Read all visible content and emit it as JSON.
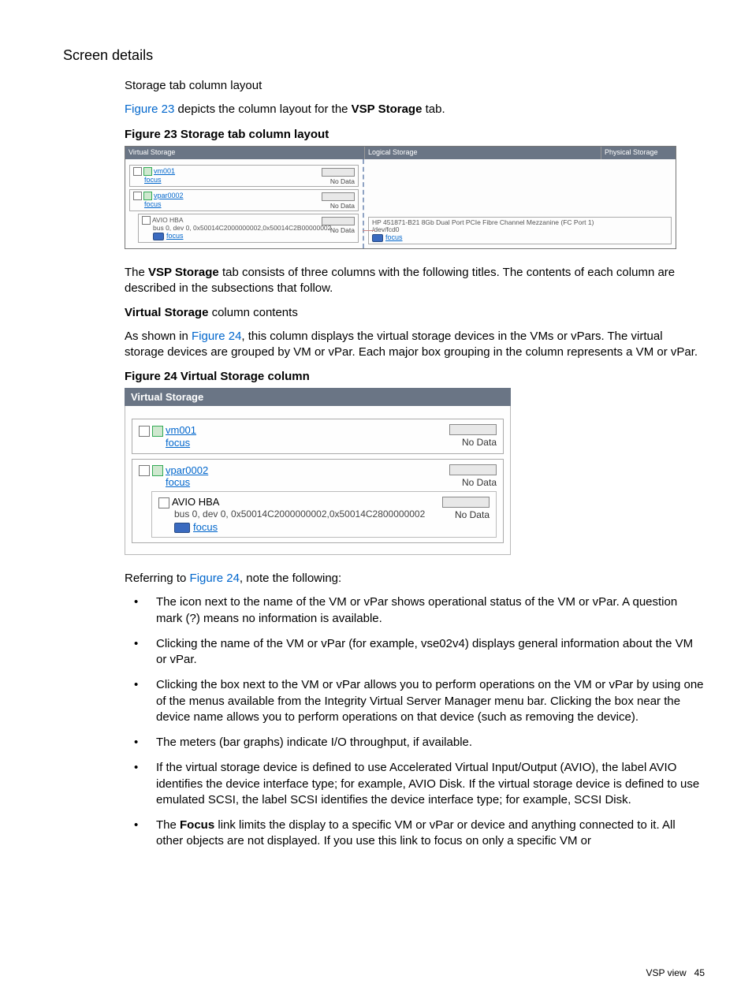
{
  "headings": {
    "screen_details": "Screen details",
    "subheading": "Storage tab column layout"
  },
  "intro": {
    "ref1": "Figure 23",
    "sentence1_rest": " depicts the column layout for the ",
    "vsp_storage": "VSP Storage",
    "sentence1_end": " tab."
  },
  "fig23": {
    "caption": "Figure 23 Storage tab column layout",
    "cols": {
      "virtual": "Virtual Storage",
      "logical": "Logical Storage",
      "physical": "Physical Storage"
    },
    "vm001": {
      "name": "vm001",
      "focus": "focus",
      "nodata": "No Data"
    },
    "vpar0002": {
      "name": "vpar0002",
      "focus": "focus",
      "nodata": "No Data"
    },
    "avio": {
      "label": "AVIO HBA",
      "bus": "bus 0, dev 0, 0x50014C2000000002,0x50014C2B00000002",
      "focus": "focus",
      "nodata": "No Data"
    },
    "logical_item": {
      "line1": "HP 451871-B21 8Gb Dual Port PCIe Fibre Channel Mezzanine (FC Port 1)",
      "line2": "/dev/fcd0",
      "focus": "focus"
    }
  },
  "mid": {
    "p1a": "The ",
    "p1b": "VSP Storage",
    "p1c": " tab consists of three columns with the following titles. The contents of each column are described in the subsections that follow.",
    "vs_bold": "Virtual Storage",
    "vs_rest": " column contents",
    "p2a": "As shown in ",
    "p2link": "Figure 24",
    "p2b": ", this column displays the virtual storage devices in the VMs or vPars. The virtual storage devices are grouped by VM or vPar. Each major box grouping in the column represents a VM or vPar."
  },
  "fig24": {
    "caption": "Figure 24 Virtual Storage column",
    "header": "Virtual Storage",
    "vm001": {
      "name": "vm001",
      "focus": "focus",
      "nodata": "No Data"
    },
    "vpar0002": {
      "name": "vpar0002",
      "focus": "focus",
      "nodata": "No Data"
    },
    "avio": {
      "label": "AVIO HBA",
      "bus": "bus 0, dev 0, 0x50014C2000000002,0x50014C2800000002",
      "focus": "focus",
      "nodata": "No Data"
    }
  },
  "after24": {
    "lead_a": "Referring to ",
    "lead_link": "Figure 24",
    "lead_b": ", note the following:"
  },
  "bullets": {
    "b1": "The icon next to the name of the VM or vPar shows operational status of the VM or vPar. A question mark (?) means no information is available.",
    "b2": "Clicking the name of the VM or vPar (for example, vse02v4) displays general information about the VM or vPar.",
    "b3": "Clicking the box next to the VM or vPar allows you to perform operations on the VM or vPar by using one of the menus available from the Integrity Virtual Server Manager menu bar. Clicking the box near the device name allows you to perform operations on that device (such as removing the device).",
    "b4": "The meters (bar graphs) indicate I/O throughput, if available.",
    "b5": "If the virtual storage device is defined to use Accelerated Virtual Input/Output (AVIO), the label AVIO identifies the device interface type; for example, AVIO Disk. If the virtual storage device is defined to use emulated SCSI, the label SCSI identifies the device interface type; for example, SCSI Disk.",
    "b6a": "The ",
    "b6bold": "Focus",
    "b6b": " link limits the display to a specific VM or vPar or device and anything connected to it. All other objects are not displayed. If you use this link to focus on only a specific VM or"
  },
  "footer": {
    "label": "VSP view",
    "page": "45"
  }
}
